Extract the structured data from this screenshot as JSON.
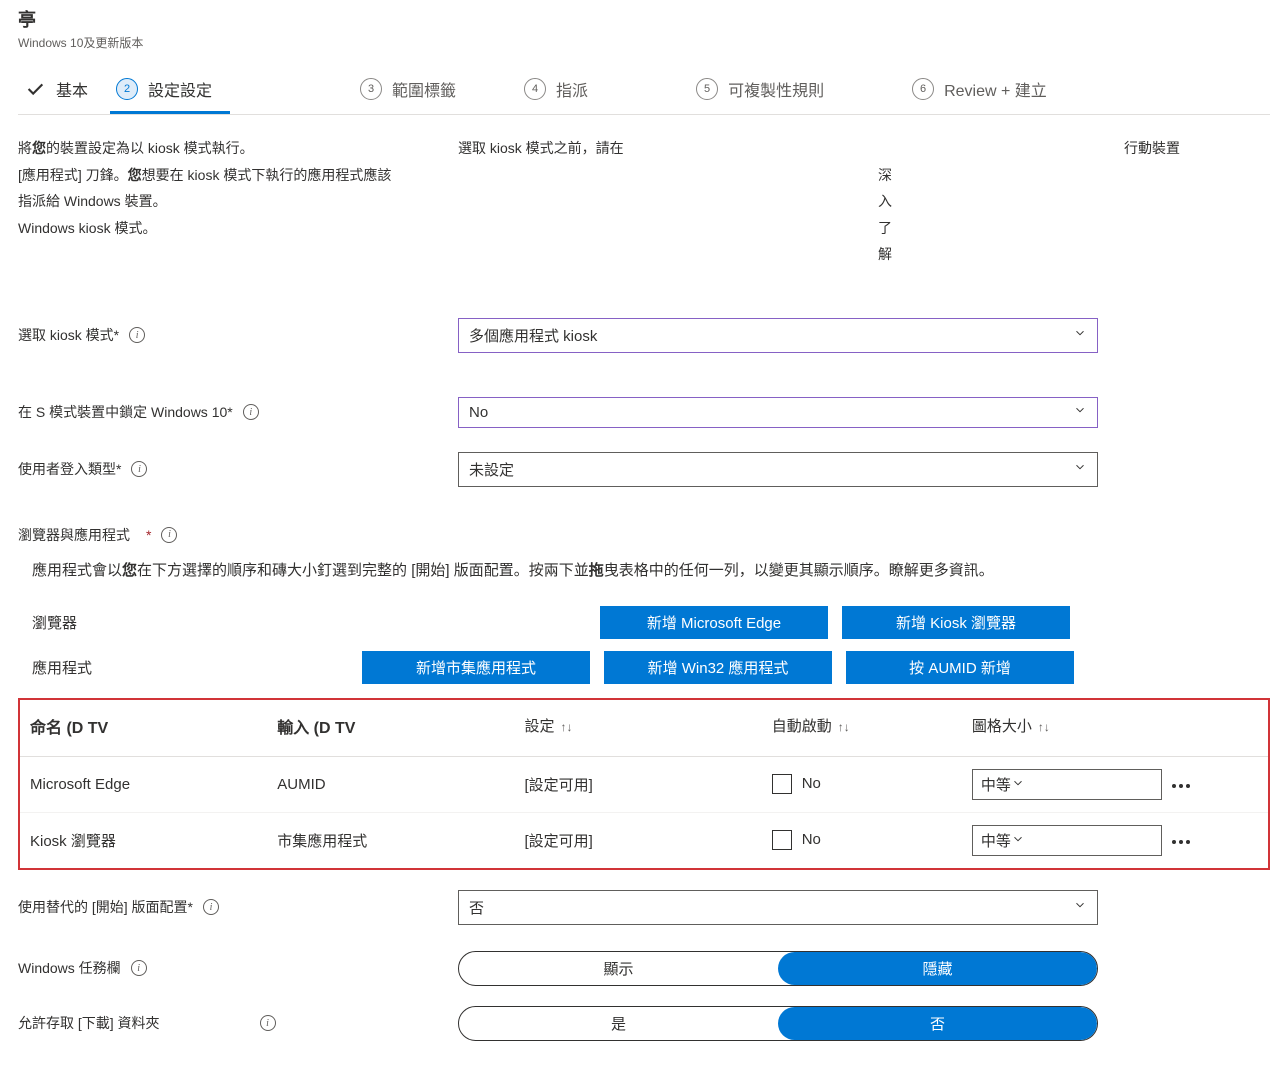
{
  "header": {
    "title": "亭",
    "subtitle": "Windows 10及更新版本"
  },
  "steps": [
    {
      "label": "基本"
    },
    {
      "num": "2",
      "label": "設定設定"
    },
    {
      "num": "3",
      "label": "範圍標籤"
    },
    {
      "num": "4",
      "label": "指派"
    },
    {
      "num": "5",
      "label": "可複製性規則"
    },
    {
      "num": "6",
      "label": "Review + 建立"
    }
  ],
  "intro": {
    "col_a_line1_pre": "將",
    "col_a_line1_bold": "您",
    "col_a_line1_post": "的裝置設定為以 kiosk 模式執行。",
    "col_a_line2_pre": "[應用程式] 刀鋒。",
    "col_a_line2_bold": "您",
    "col_a_line2_post": "想要在 kiosk 模式下執行的應用程式應該指派給 Windows 裝置。",
    "col_a_line3": "Windows kiosk 模式。",
    "col_b_line1": "選取 kiosk 模式之前，請在",
    "col_b_line2": "深入了解",
    "col_c_line1": "行動裝置"
  },
  "fields": {
    "kiosk_mode": {
      "label": "選取 kiosk 模式*",
      "value": "多個應用程式 kiosk"
    },
    "s_mode": {
      "label": "在 S 模式裝置中鎖定 Windows 10*",
      "value": "No"
    },
    "login_type": {
      "label": "使用者登入類型*",
      "value": "未設定"
    },
    "alt_start": {
      "label": "使用替代的 [開始] 版面配置*",
      "value": "否"
    },
    "taskbar": {
      "label": "Windows 任務欄",
      "show": "顯示",
      "hide": "隱藏"
    },
    "downloads": {
      "label": "允許存取 [下載] 資料夾",
      "yes": "是",
      "no": "否"
    }
  },
  "section": {
    "heading": "瀏覽器與應用程式",
    "desc_pre": "應用程式會以",
    "desc_bold1": "您",
    "desc_mid": "在下方選擇的順序和磚大小釘選到完整的 [開始] 版面配置。按兩下並",
    "desc_bold2": "拖",
    "desc_post": "曳表格中的任何一列，以變更其顯示順序。瞭解更多資訊。"
  },
  "btnrow": {
    "browsers": "瀏覽器",
    "apps": "應用程式",
    "add_edge": "新增 Microsoft Edge",
    "add_kiosk": "新增 Kiosk 瀏覽器",
    "add_store": "新增市集應用程式",
    "add_win32": "新增 Win32 應用程式",
    "add_aumid": "按 AUMID 新增"
  },
  "table": {
    "cols": {
      "name": "命名 (D TV",
      "type": "輸入 (D TV",
      "settings": "設定",
      "autostart": "自動啟動",
      "tilesize": "圖格大小"
    },
    "rows": [
      {
        "name": "Microsoft Edge",
        "type": "AUMID",
        "settings": "[設定可用]",
        "autostart": "No",
        "tilesize": "中等"
      },
      {
        "name": "Kiosk 瀏覽器",
        "type": "市集應用程式",
        "settings": "[設定可用]",
        "autostart": "No",
        "tilesize": "中等"
      }
    ]
  }
}
